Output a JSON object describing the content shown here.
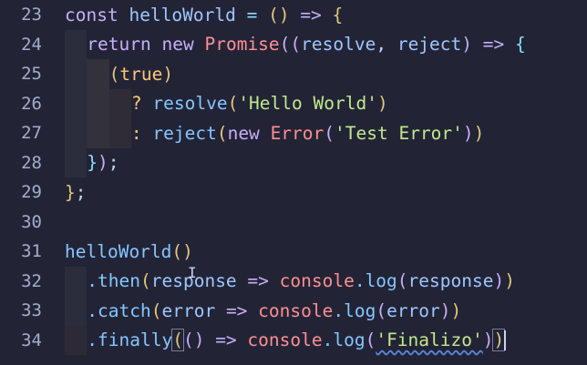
{
  "editor": {
    "lines": [
      {
        "num": "23"
      },
      {
        "num": "24"
      },
      {
        "num": "25"
      },
      {
        "num": "26"
      },
      {
        "num": "27"
      },
      {
        "num": "28"
      },
      {
        "num": "29"
      },
      {
        "num": "30"
      },
      {
        "num": "31"
      },
      {
        "num": "32"
      },
      {
        "num": "33"
      },
      {
        "num": "34"
      }
    ],
    "tokens": {
      "const": "const",
      "helloWorld": "helloWorld",
      "eq": " = ",
      "arrowParams": "()",
      "arrow": " => ",
      "brace_open": "{",
      "return": "return",
      "new": "new",
      "Promise": "Promise",
      "paren_open": "((",
      "resolve": "resolve",
      "comma": ", ",
      "reject": "reject",
      "paren_close_arrow": ")",
      "arrow2": " => ",
      "brace_open2": "{",
      "true_open": "(",
      "true": "true",
      "true_close": ")",
      "q": "? ",
      "resolve_call": "resolve",
      "str_hello": "'Hello World'",
      "colon": ": ",
      "reject_call": "reject",
      "new2": "new",
      "Error": "Error",
      "str_test": "'Test Error'",
      "close_line28": "});",
      "close_line29": "};",
      "helloWorld_call": "helloWorld",
      "call_parens": "()",
      "then": ".then",
      "response": "response",
      "console": "console",
      "log": ".log",
      "catch": ".catch",
      "error": "error",
      "finally": ".finally",
      "str_final": "'Finalizo'"
    }
  }
}
